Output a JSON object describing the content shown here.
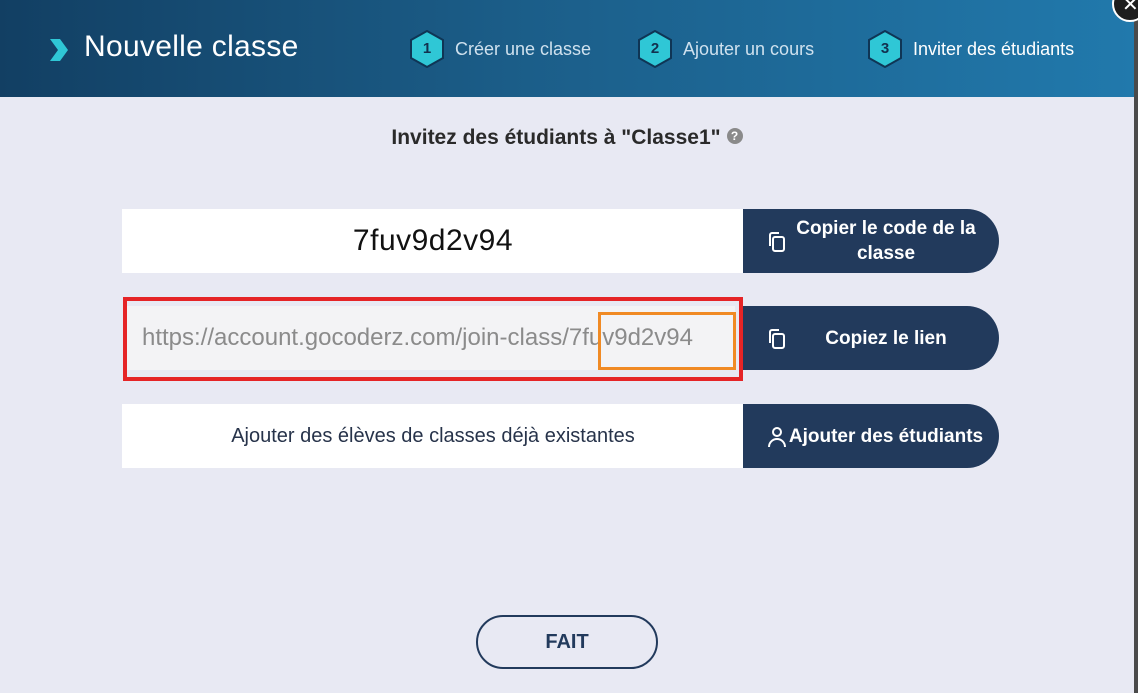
{
  "header": {
    "title": "Nouvelle classe",
    "steps": [
      {
        "number": "1",
        "label": "Créer une classe"
      },
      {
        "number": "2",
        "label": "Ajouter un cours"
      },
      {
        "number": "3",
        "label": "Inviter des étudiants"
      }
    ],
    "close_label": "✕"
  },
  "subtitle": "Invitez des étudiants à \"Classe1\"",
  "help_icon": "?",
  "class_code": {
    "value": "7fuv9d2v94",
    "copy_button_label": "Copier le code de la classe"
  },
  "invite_link": {
    "value": "https://account.gocoderz.com/join-class/7fuv9d2v94",
    "copy_button_label": "Copiez le lien"
  },
  "existing_students": {
    "label": "Ajouter des élèves de classes déjà existantes",
    "button_label": "Ajouter des étudiants"
  },
  "done_button_label": "FAIT",
  "colors": {
    "header_start": "#123f63",
    "header_end": "#2179ac",
    "accent_teal": "#2fc7d6",
    "button_dark": "#223a5c",
    "highlight_red": "#e52426",
    "highlight_orange": "#f08a24"
  },
  "icons": [
    "chevron-right-icon",
    "help-icon",
    "copy-icon",
    "user-icon",
    "close-icon"
  ]
}
